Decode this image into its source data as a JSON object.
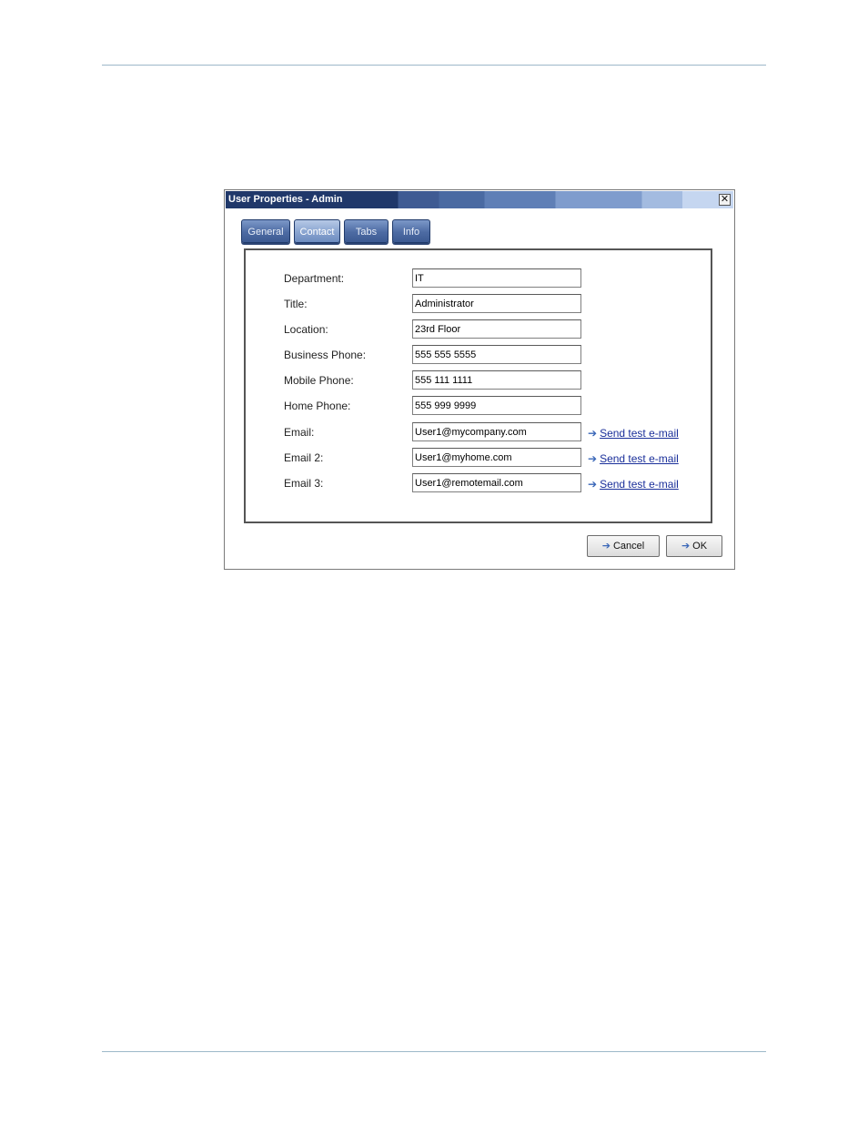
{
  "dialog": {
    "title": "User Properties - Admin",
    "close_label": "✕"
  },
  "tabs": [
    {
      "label": "General",
      "active": false
    },
    {
      "label": "Contact",
      "active": true
    },
    {
      "label": "Tabs",
      "active": false
    },
    {
      "label": "Info",
      "active": false
    }
  ],
  "fields": [
    {
      "label": "Department:",
      "value": "IT"
    },
    {
      "label": "Title:",
      "value": "Administrator"
    },
    {
      "label": "Location:",
      "value": "23rd Floor"
    },
    {
      "label": "Business Phone:",
      "value": "555 555 5555"
    },
    {
      "label": "Mobile Phone:",
      "value": "555 111 1111"
    },
    {
      "label": "Home Phone:",
      "value": "555 999 9999"
    },
    {
      "label": "Email:",
      "value": "User1@mycompany.com",
      "link": "Send test e-mail"
    },
    {
      "label": "Email 2:",
      "value": "User1@myhome.com",
      "link": "Send test e-mail"
    },
    {
      "label": "Email 3:",
      "value": "User1@remotemail.com",
      "link": "Send test e-mail"
    }
  ],
  "buttons": {
    "cancel_label": "Cancel",
    "ok_label": "OK"
  },
  "icons": {
    "arrow": "➔"
  },
  "colors": {
    "titlebar": "#20386a",
    "tab": "#4d6ba3",
    "link": "#1a2f9a"
  }
}
